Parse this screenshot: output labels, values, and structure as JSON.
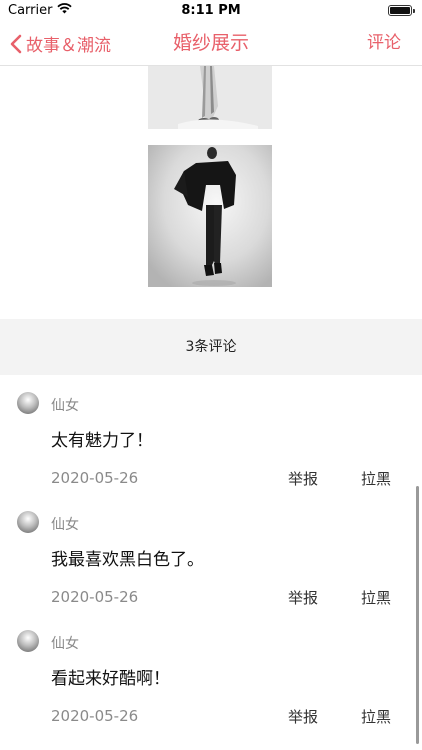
{
  "status_bar": {
    "carrier": "Carrier",
    "time": "8:11 PM"
  },
  "nav": {
    "back_label": "故事＆潮流",
    "title": "婚纱展示",
    "right_label": "评论",
    "accent_color": "#e8606a"
  },
  "comment_count": "3条评论",
  "comments": [
    {
      "username": "仙女",
      "text": "太有魅力了！",
      "date": "2020-05-26",
      "report_label": "举报",
      "block_label": "拉黑"
    },
    {
      "username": "仙女",
      "text": "我最喜欢黑白色了。",
      "date": "2020-05-26",
      "report_label": "举报",
      "block_label": "拉黑"
    },
    {
      "username": "仙女",
      "text": "看起来好酷啊！",
      "date": "2020-05-26",
      "report_label": "举报",
      "block_label": "拉黑"
    }
  ]
}
